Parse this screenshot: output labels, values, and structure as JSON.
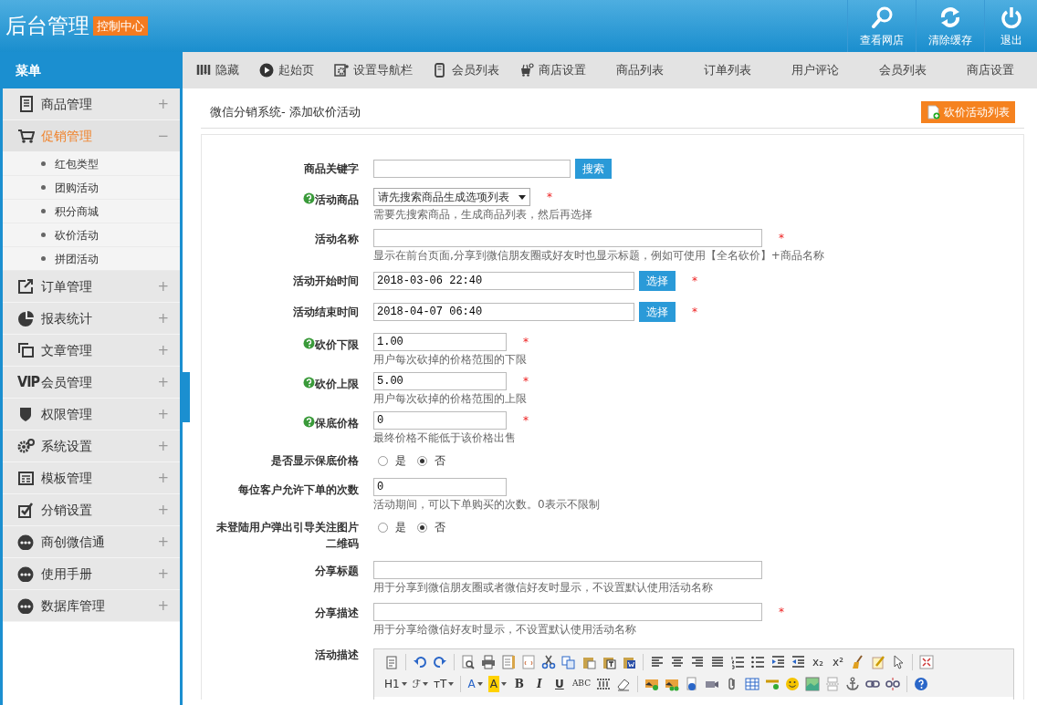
{
  "header": {
    "title": "后台管理",
    "badge": "控制中心",
    "actions": [
      {
        "label": "查看网店"
      },
      {
        "label": "清除缓存"
      },
      {
        "label": "退出"
      }
    ]
  },
  "sidebar": {
    "title": "菜单",
    "items": [
      {
        "label": "商品管理",
        "expanded": false,
        "selected": false
      },
      {
        "label": "促销管理",
        "expanded": true,
        "selected": true,
        "children": [
          {
            "label": "红包类型"
          },
          {
            "label": "团购活动"
          },
          {
            "label": "积分商城"
          },
          {
            "label": "砍价活动"
          },
          {
            "label": "拼团活动"
          }
        ]
      },
      {
        "label": "订单管理",
        "expanded": false,
        "selected": false
      },
      {
        "label": "报表统计",
        "expanded": false,
        "selected": false
      },
      {
        "label": "文章管理",
        "expanded": false,
        "selected": false
      },
      {
        "label": "会员管理",
        "expanded": false,
        "selected": false,
        "icon_text": "VIP"
      },
      {
        "label": "权限管理",
        "expanded": false,
        "selected": false
      },
      {
        "label": "系统设置",
        "expanded": false,
        "selected": false
      },
      {
        "label": "模板管理",
        "expanded": false,
        "selected": false
      },
      {
        "label": "分销设置",
        "expanded": false,
        "selected": false
      },
      {
        "label": "商创微信通",
        "expanded": false,
        "selected": false
      },
      {
        "label": "使用手册",
        "expanded": false,
        "selected": false
      },
      {
        "label": "数据库管理",
        "expanded": false,
        "selected": false
      }
    ],
    "toggle": "+",
    "collapse": "−"
  },
  "toolbar": {
    "items": [
      {
        "label": "隐藏",
        "kind": "icon"
      },
      {
        "label": "起始页",
        "kind": "icon"
      },
      {
        "label": "设置导航栏",
        "kind": "icon"
      },
      {
        "label": "会员列表",
        "kind": "icon"
      },
      {
        "label": "商店设置",
        "kind": "icon"
      },
      {
        "label": "商品列表",
        "kind": "plain"
      },
      {
        "label": "订单列表",
        "kind": "plain"
      },
      {
        "label": "用户评论",
        "kind": "plain"
      },
      {
        "label": "会员列表",
        "kind": "plain"
      },
      {
        "label": "商店设置",
        "kind": "plain"
      }
    ]
  },
  "page": {
    "title": "微信分销系统- 添加砍价活动",
    "action": "砍价活动列表"
  },
  "form": {
    "fields": [
      {
        "kind": "search",
        "label": "商品关键字",
        "help": false,
        "required": false,
        "button": "搜索"
      },
      {
        "kind": "select",
        "label": "活动商品",
        "help": true,
        "required": true,
        "value": "请先搜索商品生成选项列表",
        "hint": "需要先搜索商品，生成商品列表，然后再选择"
      },
      {
        "kind": "text",
        "label": "活动名称",
        "help": false,
        "required": true,
        "hint": "显示在前台页面,分享到微信朋友圈或好友时也显示标题，例如可使用【全名砍价】+商品名称"
      },
      {
        "kind": "datetime",
        "label": "活动开始时间",
        "help": false,
        "required": true,
        "value": "2018-03-06 22:40",
        "button": "选择"
      },
      {
        "kind": "datetime",
        "label": "活动结束时间",
        "help": false,
        "required": true,
        "value": "2018-04-07 06:40",
        "button": "选择"
      },
      {
        "kind": "number",
        "label": "砍价下限",
        "help": true,
        "required": true,
        "value": "1.00",
        "hint": "用户每次砍掉的价格范围的下限"
      },
      {
        "kind": "number",
        "label": "砍价上限",
        "help": true,
        "required": true,
        "value": "5.00",
        "hint": "用户每次砍掉的价格范围的上限"
      },
      {
        "kind": "number",
        "label": "保底价格",
        "help": true,
        "required": true,
        "value": "0",
        "hint": "最终价格不能低于该价格出售"
      },
      {
        "kind": "radio",
        "label": "是否显示保底价格",
        "help": false,
        "required": false,
        "options": [
          {
            "label": "是",
            "selected": false
          },
          {
            "label": "否",
            "selected": true
          }
        ]
      },
      {
        "kind": "number",
        "label": "每位客户允许下单的次数",
        "help": false,
        "required": false,
        "value": "0",
        "hint": "活动期间，可以下单购买的次数。0表示不限制"
      },
      {
        "kind": "radio",
        "label": "未登陆用户弹出引导关注图片二维码",
        "help": false,
        "required": false,
        "options": [
          {
            "label": "是",
            "selected": false
          },
          {
            "label": "否",
            "selected": true
          }
        ]
      },
      {
        "kind": "text",
        "label": "分享标题",
        "help": false,
        "required": false,
        "hint": "用于分享到微信朋友圈或者微信好友时显示，不设置默认使用活动名称"
      },
      {
        "kind": "text",
        "label": "分享描述",
        "help": false,
        "required": true,
        "hint": "用于分享给微信好友时显示，不设置默认使用活动名称"
      },
      {
        "kind": "editor",
        "label": "活动描述",
        "help": false,
        "required": false
      }
    ],
    "required_mark": "*",
    "editor_toolbar": [
      [
        {
          "kind": "icon"
        },
        {
          "kind": "sep"
        },
        {
          "kind": "icon"
        },
        {
          "kind": "icon"
        },
        {
          "kind": "sep"
        },
        {
          "kind": "icon"
        },
        {
          "kind": "icon"
        },
        {
          "kind": "icon"
        },
        {
          "kind": "icon"
        },
        {
          "kind": "icon"
        },
        {
          "kind": "icon"
        },
        {
          "kind": "icon"
        },
        {
          "kind": "icon"
        },
        {
          "kind": "icon"
        },
        {
          "kind": "sep"
        },
        {
          "kind": "icon"
        },
        {
          "kind": "icon"
        },
        {
          "kind": "icon"
        },
        {
          "kind": "icon"
        },
        {
          "kind": "icon"
        },
        {
          "kind": "icon"
        },
        {
          "kind": "icon"
        },
        {
          "kind": "icon"
        },
        {
          "kind": "text",
          "label": "x₂"
        },
        {
          "kind": "text",
          "label": "x²"
        },
        {
          "kind": "icon"
        },
        {
          "kind": "icon"
        },
        {
          "kind": "icon"
        },
        {
          "kind": "sep"
        },
        {
          "kind": "icon"
        }
      ],
      [
        {
          "kind": "text",
          "label": "H1",
          "dropdown": true
        },
        {
          "kind": "text",
          "label": "ℱ",
          "dropdown": true
        },
        {
          "kind": "text",
          "label": "ᴛT",
          "dropdown": true
        },
        {
          "kind": "sep"
        },
        {
          "kind": "text",
          "label": "A",
          "dropdown": true
        },
        {
          "kind": "text",
          "label": "A",
          "dropdown": true
        },
        {
          "kind": "text",
          "label": "B"
        },
        {
          "kind": "text",
          "label": "I"
        },
        {
          "kind": "text",
          "label": "U"
        },
        {
          "kind": "text",
          "label": "ABC"
        },
        {
          "kind": "icon"
        },
        {
          "kind": "icon"
        },
        {
          "kind": "sep"
        },
        {
          "kind": "icon"
        },
        {
          "kind": "icon"
        },
        {
          "kind": "icon"
        },
        {
          "kind": "icon"
        },
        {
          "kind": "icon"
        },
        {
          "kind": "icon"
        },
        {
          "kind": "icon"
        },
        {
          "kind": "icon"
        },
        {
          "kind": "icon"
        },
        {
          "kind": "icon"
        },
        {
          "kind": "icon"
        },
        {
          "kind": "icon"
        },
        {
          "kind": "icon"
        },
        {
          "kind": "sep"
        },
        {
          "kind": "icon"
        }
      ]
    ]
  }
}
